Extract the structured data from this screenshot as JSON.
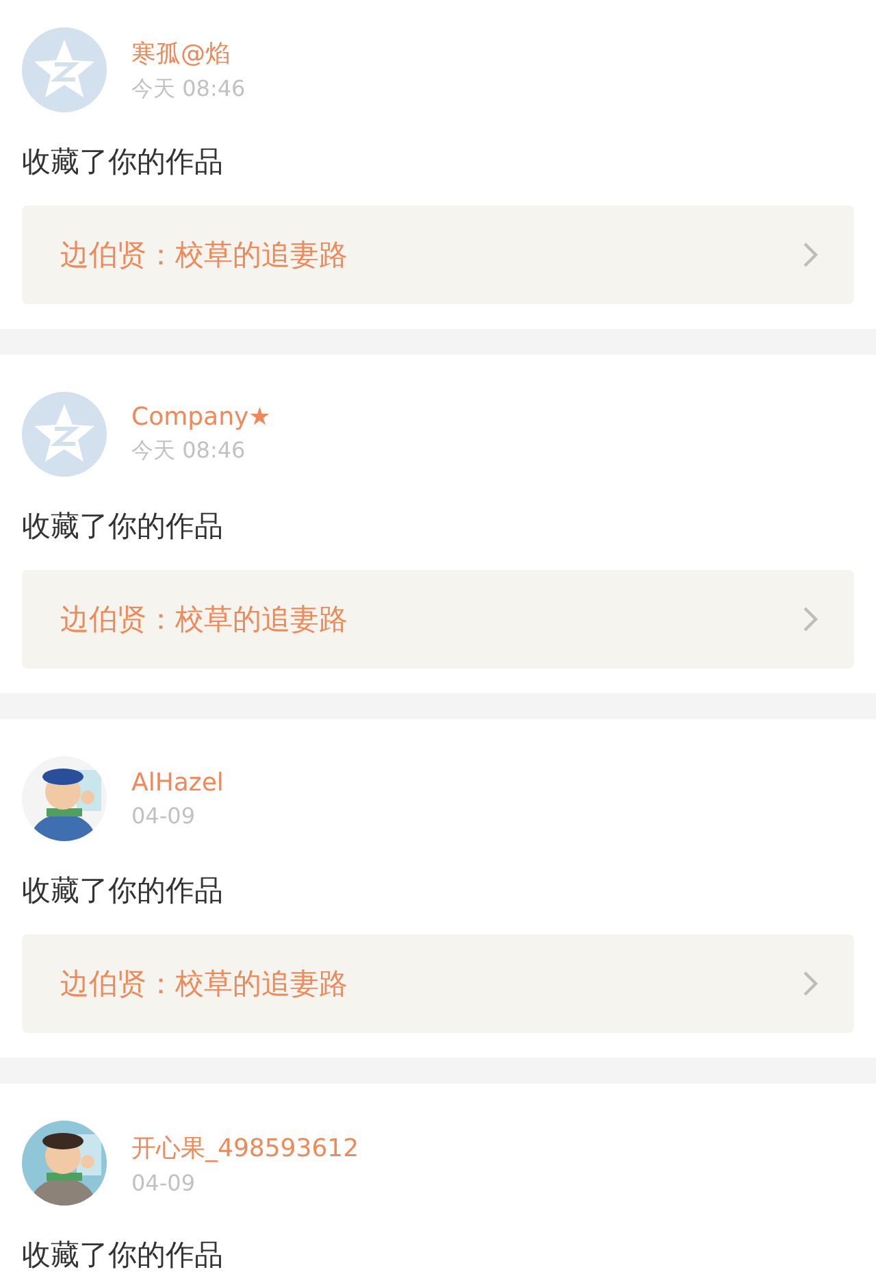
{
  "notifications": [
    {
      "user": "寒孤@焰",
      "avatar": {
        "kind": "default"
      },
      "time": "今天 08:46",
      "message": "收藏了你的作品",
      "work": {
        "title": "边伯贤：校草的追妻路"
      }
    },
    {
      "user": "Company★",
      "avatar": {
        "kind": "default"
      },
      "time": "今天 08:46",
      "message": "收藏了你的作品",
      "work": {
        "title": "边伯贤：校草的追妻路"
      }
    },
    {
      "user": "AlHazel",
      "time": "04-09",
      "message": "收藏了你的作品",
      "work": {
        "title": "边伯贤：校草的追妻路"
      }
    },
    {
      "user": "开心果_498593612",
      "time": "04-09",
      "message": "收藏了你的作品"
    }
  ]
}
